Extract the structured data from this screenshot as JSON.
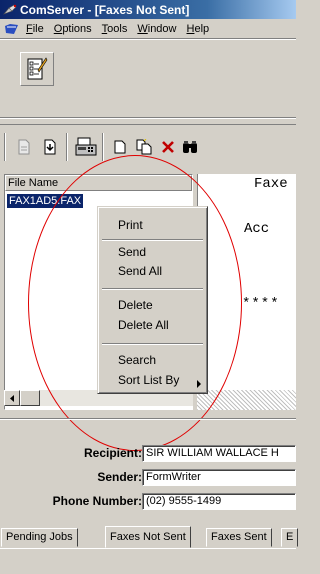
{
  "window": {
    "title": "ComServer - [Faxes Not Sent]",
    "icon": "fax-satellite-icon"
  },
  "menubar": {
    "items": [
      {
        "label": "File",
        "icon": "app-doc-icon"
      },
      {
        "label": "Options"
      },
      {
        "label": "Tools"
      },
      {
        "label": "Window"
      },
      {
        "label": "Help"
      }
    ]
  },
  "toolbar1": {
    "buttons": [
      {
        "icon": "form-edit-icon"
      }
    ]
  },
  "toolbar2": {
    "buttons": [
      {
        "icon": "document-disabled-icon"
      },
      {
        "icon": "import-document-icon"
      },
      {
        "icon": "fax-machine-icon"
      },
      {
        "icon": "new-page-icon"
      },
      {
        "icon": "copy-page-icon"
      },
      {
        "icon": "delete-x-icon"
      },
      {
        "icon": "binoculars-icon"
      }
    ]
  },
  "list": {
    "column_header": "File Name",
    "rows": [
      "FAX1AD5.FAX"
    ]
  },
  "preview": {
    "line1": "Faxe",
    "line2": "Acc",
    "line3": "****"
  },
  "context_menu": {
    "items": [
      {
        "label": "Print"
      },
      {
        "label": "Send"
      },
      {
        "label": "Send All"
      },
      {
        "label": "Delete"
      },
      {
        "label": "Delete All"
      },
      {
        "label": "Search"
      },
      {
        "label": "Sort List By",
        "has_submenu": true
      }
    ]
  },
  "details": {
    "recipient_label": "Recipient:",
    "recipient_value": "SIR WILLIAM WALLACE H",
    "sender_label": "Sender:",
    "sender_value": "FormWriter",
    "phone_label": "Phone Number:",
    "phone_value": "(02) 9555-1499"
  },
  "tabs": [
    {
      "label": "Pending Jobs",
      "active": false
    },
    {
      "label": "Faxes Not Sent",
      "active": true
    },
    {
      "label": "Faxes Sent",
      "active": false
    },
    {
      "label": "E",
      "active": false
    }
  ],
  "annotation": {
    "color": "#e00000"
  }
}
